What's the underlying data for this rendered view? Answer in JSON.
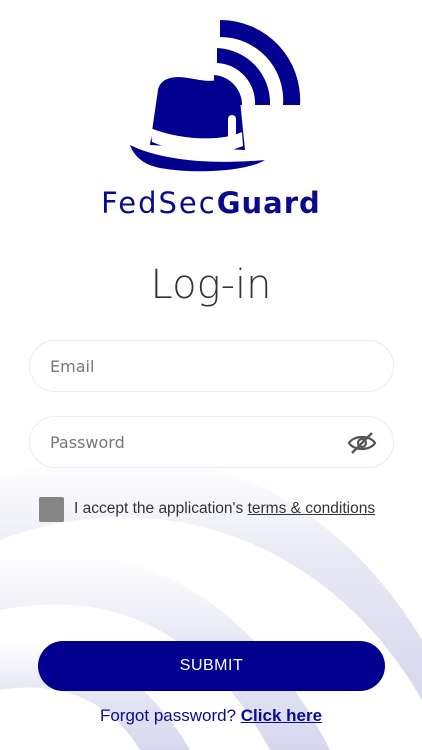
{
  "brand": {
    "name_light": "FedSec",
    "name_bold": "Guard"
  },
  "page": {
    "title": "Log-in"
  },
  "form": {
    "email_placeholder": "Email",
    "password_placeholder": "Password",
    "terms_prefix": "I accept the application's ",
    "terms_link": "terms & conditions",
    "submit_label": "SUBMIT"
  },
  "footer": {
    "forgot_text": "Forgot password? ",
    "forgot_link": "Click here"
  },
  "icons": {
    "password_toggle": "eye-off-icon",
    "logo": "hat-signal-logo"
  },
  "colors": {
    "brand": "#02008f",
    "checkbox": "#858585",
    "background": "#ffffff"
  }
}
